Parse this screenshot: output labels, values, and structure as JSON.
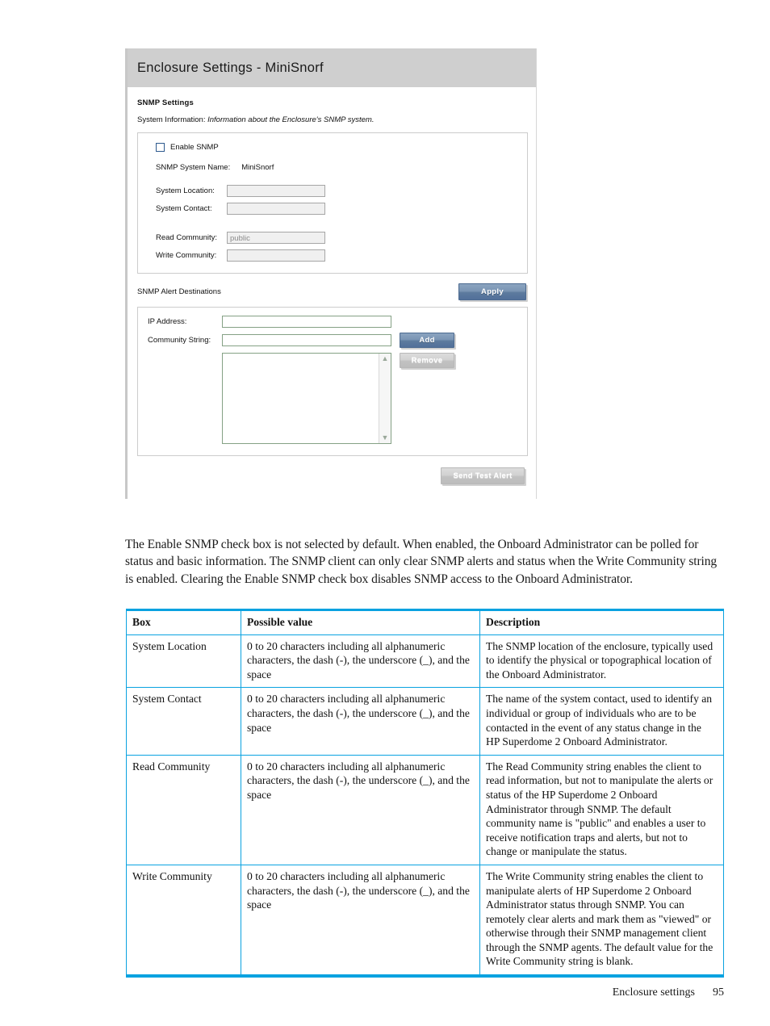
{
  "screenshot": {
    "window_title": "Enclosure Settings - MiniSnorf",
    "section_heading": "SNMP Settings",
    "system_information_label": "System Information:",
    "system_information_value": "Information about the Enclosure's SNMP system.",
    "enable_snmp_label": "Enable SNMP",
    "snmp_system_name_label": "SNMP System Name:",
    "snmp_system_name_value": "MiniSnorf",
    "fields": [
      {
        "label": "System Location:",
        "value": ""
      },
      {
        "label": "System Contact:",
        "value": ""
      },
      {
        "label": "Read Community:",
        "value": "public"
      },
      {
        "label": "Write Community:",
        "value": ""
      }
    ],
    "apply_button": "Apply",
    "alert_destinations_label": "SNMP Alert Destinations",
    "ip_address_label": "IP Address:",
    "ip_address_value": "",
    "community_string_label": "Community String:",
    "community_string_value": "",
    "add_button": "Add",
    "remove_button": "Remove",
    "send_test_alert_button": "Send Test Alert",
    "scroll_up_glyph": "▲",
    "scroll_down_glyph": "▼",
    "accent_blue": "#5d7b9e",
    "titlebar_gray": "#cfcfcf"
  },
  "paragraph": "The Enable SNMP check box is not selected by default. When enabled, the Onboard Administrator can be polled for status and basic information. The SNMP client can only clear SNMP alerts and status when the Write Community string is enabled. Clearing the Enable SNMP check box disables SNMP access to the Onboard Administrator.",
  "table": {
    "border_color": "#0aa2e0",
    "headers": [
      "Box",
      "Possible value",
      "Description"
    ],
    "rows": [
      {
        "box": "System Location",
        "possible_value": "0 to 20 characters including all alphanumeric characters, the dash (-), the underscore (_), and the space",
        "description": "The SNMP location of the enclosure, typically used to identify the physical or topographical location of the Onboard Administrator."
      },
      {
        "box": "System Contact",
        "possible_value": "0 to 20 characters including all alphanumeric characters, the dash (-), the underscore (_), and the space",
        "description": "The name of the system contact, used to identify an individual or group of individuals who are to be contacted in the event of any status change in the HP Superdome 2 Onboard Administrator."
      },
      {
        "box": "Read Community",
        "possible_value": "0 to 20 characters including all alphanumeric characters, the dash (-), the underscore (_), and the space",
        "description": "The Read Community string enables the client to read information, but not to manipulate the alerts or status of the HP Superdome 2 Onboard Administrator through SNMP. The default community name is \"public\" and enables a user to receive notification traps and alerts, but not to change or manipulate the status."
      },
      {
        "box": "Write Community",
        "possible_value": "0 to 20 characters including all alphanumeric characters, the dash (-), the underscore (_), and the space",
        "description": "The Write Community string enables the client to manipulate alerts of HP Superdome 2 Onboard Administrator status through SNMP. You can remotely clear alerts and mark them as \"viewed\" or otherwise through their SNMP management client through the SNMP agents. The default value for the Write Community string is blank."
      }
    ]
  },
  "footer": {
    "chapter": "Enclosure settings",
    "page_number": "95"
  }
}
